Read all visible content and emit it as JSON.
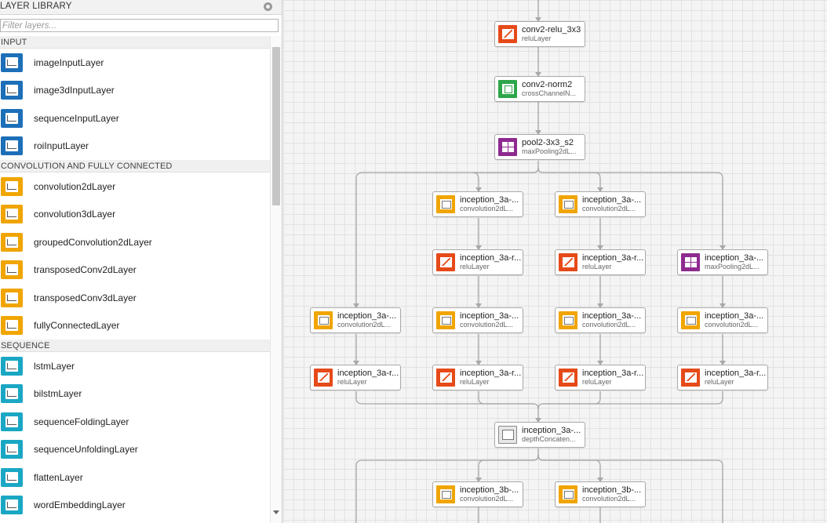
{
  "library": {
    "title": "LAYER LIBRARY",
    "filter_placeholder": "Filter layers...",
    "sections": [
      {
        "name": "INPUT",
        "icon_color": "#1d6fb8",
        "items": [
          {
            "label": "imageInputLayer",
            "icon": "image-input-icon"
          },
          {
            "label": "image3dInputLayer",
            "icon": "image3d-input-icon"
          },
          {
            "label": "sequenceInputLayer",
            "icon": "sequence-input-icon"
          },
          {
            "label": "roiInputLayer",
            "icon": "roi-input-icon"
          }
        ]
      },
      {
        "name": "CONVOLUTION AND FULLY CONNECTED",
        "icon_color": "#f0a500",
        "items": [
          {
            "label": "convolution2dLayer",
            "icon": "convolution2d-icon"
          },
          {
            "label": "convolution3dLayer",
            "icon": "convolution3d-icon"
          },
          {
            "label": "groupedConvolution2dLayer",
            "icon": "grouped-convolution-icon"
          },
          {
            "label": "transposedConv2dLayer",
            "icon": "transposed-conv2d-icon"
          },
          {
            "label": "transposedConv3dLayer",
            "icon": "transposed-conv3d-icon"
          },
          {
            "label": "fullyConnectedLayer",
            "icon": "fully-connected-icon"
          }
        ]
      },
      {
        "name": "SEQUENCE",
        "icon_color": "#1aa7c4",
        "items": [
          {
            "label": "lstmLayer",
            "icon": "lstm-icon"
          },
          {
            "label": "bilstmLayer",
            "icon": "bilstm-icon"
          },
          {
            "label": "sequenceFoldingLayer",
            "icon": "sequence-folding-icon"
          },
          {
            "label": "sequenceUnfoldingLayer",
            "icon": "sequence-unfolding-icon"
          },
          {
            "label": "flattenLayer",
            "icon": "flatten-icon"
          },
          {
            "label": "wordEmbeddingLayer",
            "icon": "word-embedding-icon"
          }
        ]
      }
    ]
  },
  "canvas": {
    "nodes": [
      {
        "id": "n1",
        "name": "conv2-relu_3x3",
        "type": "reluLayer",
        "kind": "relu"
      },
      {
        "id": "n2",
        "name": "conv2-norm2",
        "type": "crossChannelN...",
        "kind": "norm"
      },
      {
        "id": "n3",
        "name": "pool2-3x3_s2",
        "type": "maxPooling2dL...",
        "kind": "pool"
      },
      {
        "id": "n4",
        "name": "inception_3a-...",
        "type": "convolution2dL...",
        "kind": "conv"
      },
      {
        "id": "n5",
        "name": "inception_3a-...",
        "type": "convolution2dL...",
        "kind": "conv"
      },
      {
        "id": "n6",
        "name": "inception_3a-r...",
        "type": "reluLayer",
        "kind": "relu"
      },
      {
        "id": "n7",
        "name": "inception_3a-r...",
        "type": "reluLayer",
        "kind": "relu"
      },
      {
        "id": "n8",
        "name": "inception_3a-...",
        "type": "maxPooling2dL...",
        "kind": "pool"
      },
      {
        "id": "n9",
        "name": "inception_3a-...",
        "type": "convolution2dL...",
        "kind": "conv"
      },
      {
        "id": "n10",
        "name": "inception_3a-...",
        "type": "convolution2dL...",
        "kind": "conv"
      },
      {
        "id": "n11",
        "name": "inception_3a-...",
        "type": "convolution2dL...",
        "kind": "conv"
      },
      {
        "id": "n12",
        "name": "inception_3a-...",
        "type": "convolution2dL...",
        "kind": "conv"
      },
      {
        "id": "n13",
        "name": "inception_3a-r...",
        "type": "reluLayer",
        "kind": "relu"
      },
      {
        "id": "n14",
        "name": "inception_3a-r...",
        "type": "reluLayer",
        "kind": "relu"
      },
      {
        "id": "n15",
        "name": "inception_3a-r...",
        "type": "reluLayer",
        "kind": "relu"
      },
      {
        "id": "n16",
        "name": "inception_3a-r...",
        "type": "reluLayer",
        "kind": "relu"
      },
      {
        "id": "n17",
        "name": "inception_3a-...",
        "type": "depthConcaten...",
        "kind": "concat"
      },
      {
        "id": "n18",
        "name": "inception_3b-...",
        "type": "convolution2dL...",
        "kind": "conv"
      },
      {
        "id": "n19",
        "name": "inception_3b-...",
        "type": "convolution2dL...",
        "kind": "conv"
      }
    ]
  }
}
